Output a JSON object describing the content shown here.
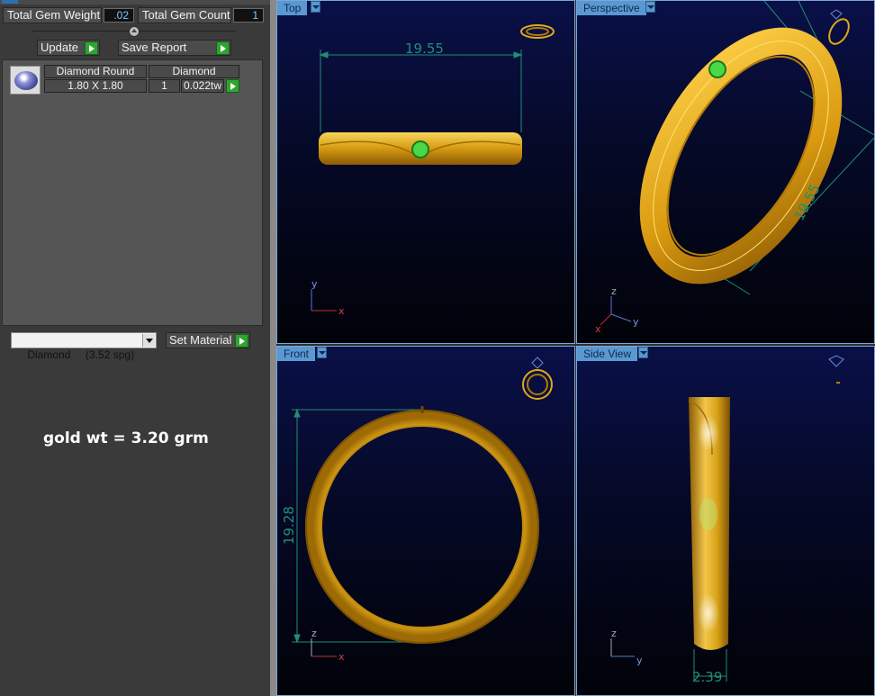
{
  "gem_panel": {
    "total_weight_label": "Total Gem Weight",
    "total_weight_value": ".02",
    "total_count_label": "Total Gem Count",
    "total_count_value": "1",
    "update_label": "Update",
    "save_report_label": "Save Report",
    "columns": [
      "Diamond Round",
      "Diamond"
    ],
    "row": {
      "size": "1.80 X 1.80",
      "count": "1",
      "weight": "0.022tw"
    }
  },
  "material": {
    "selected": "Diamond     (3.52 spg)",
    "set_label": "Set Material"
  },
  "note": "gold wt = 3.20 grm",
  "viewports": {
    "top": {
      "label": "Top",
      "dimension": "19.55",
      "axes": [
        "y",
        "x"
      ]
    },
    "perspective": {
      "label": "Perspective",
      "dimension": "19.55",
      "axes": [
        "z",
        "y",
        "x"
      ]
    },
    "front": {
      "label": "Front",
      "dimension": "19.28",
      "axes": [
        "z",
        "x"
      ]
    },
    "side": {
      "label": "Side View",
      "dimension": "2.39",
      "axes": [
        "z",
        "y"
      ]
    }
  },
  "colors": {
    "gold": "#e0a818",
    "dimension": "#1f8f73",
    "gem": "#48d848",
    "viewport_tab": "#5a98d2"
  }
}
